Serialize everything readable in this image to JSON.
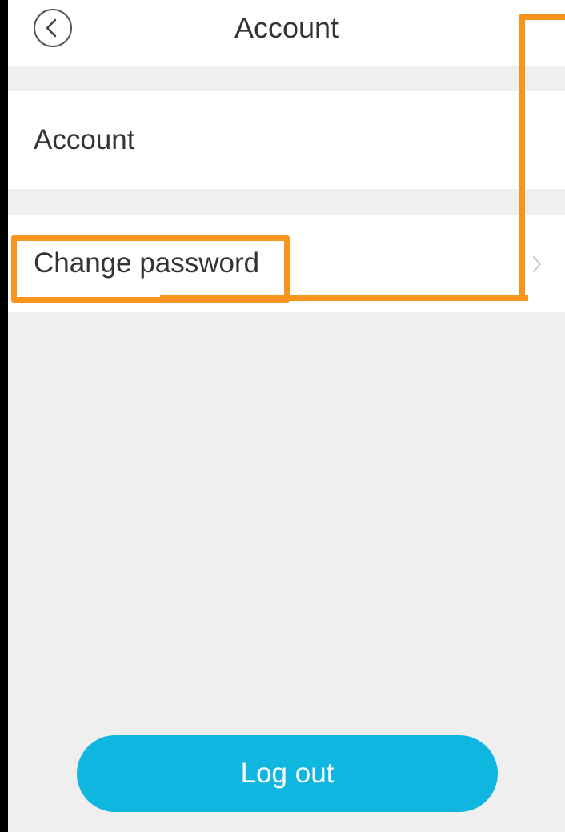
{
  "header": {
    "title": "Account",
    "back_icon": "chevron-left-circle-icon"
  },
  "rows": [
    {
      "label": "Account"
    },
    {
      "label": "Change password",
      "chevron_icon": "chevron-right-icon"
    }
  ],
  "logout": {
    "label": "Log out"
  },
  "colors": {
    "accent": "#0fb6e0",
    "highlight": "#f7941d",
    "background": "#efefef",
    "text": "#333333"
  }
}
